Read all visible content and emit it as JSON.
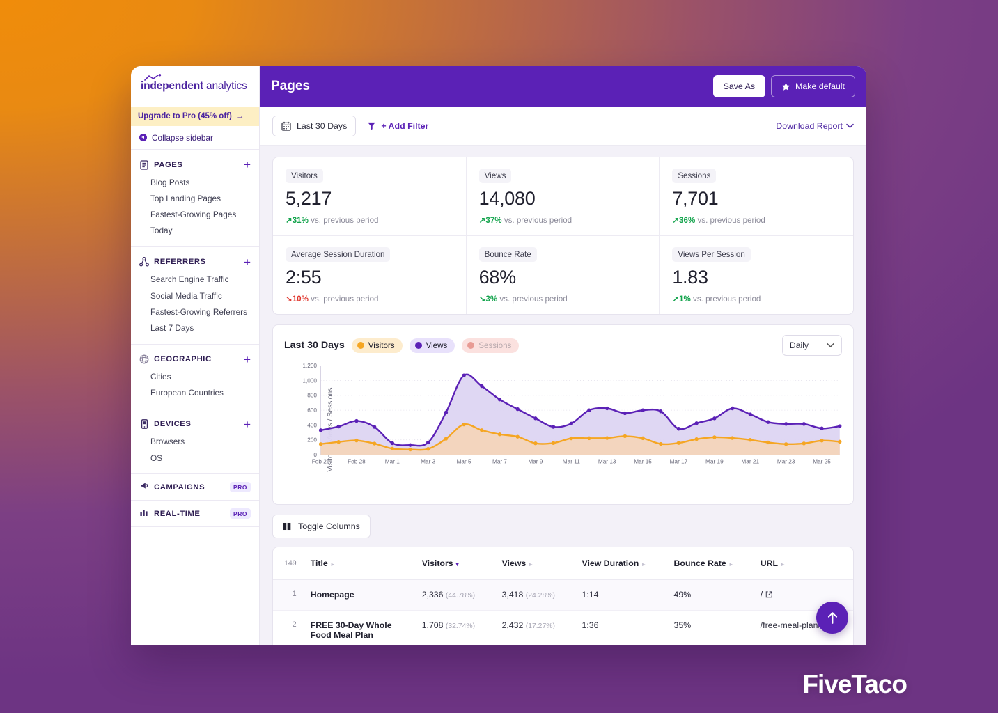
{
  "window": {
    "sidebar": {
      "logo": {
        "bold": "independent",
        "light": " analytics"
      },
      "upgrade": {
        "label": "Upgrade to Pro (45% off)",
        "arrow": "→"
      },
      "collapse": {
        "label": "Collapse sidebar"
      },
      "groups": [
        {
          "title": "PAGES",
          "icon": "document-icon",
          "plus": "+",
          "items": [
            "Blog Posts",
            "Top Landing Pages",
            "Fastest-Growing Pages",
            "Today"
          ]
        },
        {
          "title": "REFERRERS",
          "icon": "share-nodes-icon",
          "plus": "+",
          "items": [
            "Search Engine Traffic",
            "Social Media Traffic",
            "Fastest-Growing Referrers",
            "Last 7 Days"
          ]
        },
        {
          "title": "GEOGRAPHIC",
          "icon": "globe-icon",
          "plus": "+",
          "items": [
            "Cities",
            "European Countries"
          ]
        },
        {
          "title": "DEVICES",
          "icon": "mobile-icon",
          "plus": "+",
          "items": [
            "Browsers",
            "OS"
          ]
        }
      ],
      "pro_rows": [
        {
          "title": "CAMPAIGNS",
          "icon": "megaphone-icon",
          "badge": "PRO"
        },
        {
          "title": "REAL-TIME",
          "icon": "bar-chart-icon",
          "badge": "PRO"
        }
      ]
    },
    "topbar": {
      "title": "Pages",
      "save_as_label": "Save As",
      "make_default_label": "Make default"
    },
    "filterbar": {
      "date_range": "Last 30 Days",
      "add_filter": "+ Add Filter",
      "download_report": "Download Report",
      "chevron": "⌄"
    },
    "stats": [
      {
        "label": "Visitors",
        "value": "5,217",
        "delta": "31%",
        "dir": "up",
        "note": "vs. previous period"
      },
      {
        "label": "Views",
        "value": "14,080",
        "delta": "37%",
        "dir": "up",
        "note": "vs. previous period"
      },
      {
        "label": "Sessions",
        "value": "7,701",
        "delta": "36%",
        "dir": "up",
        "note": "vs. previous period"
      },
      {
        "label": "Average Session Duration",
        "value": "2:55",
        "delta": "10%",
        "dir": "down",
        "note": "vs. previous period"
      },
      {
        "label": "Bounce Rate",
        "value": "68%",
        "delta": "3%",
        "dir": "down",
        "note": "vs. previous period"
      },
      {
        "label": "Views Per Session",
        "value": "1.83",
        "delta": "1%",
        "dir": "up",
        "note": "vs. previous period"
      }
    ],
    "chart_card": {
      "title": "Last 30 Days",
      "legend": [
        {
          "name": "Visitors",
          "color": "#f5a623",
          "active": true
        },
        {
          "name": "Views",
          "color": "#5b21b6",
          "active": true
        },
        {
          "name": "Sessions",
          "color": "#e89b94",
          "active": false
        }
      ],
      "interval_select": {
        "value": "Daily",
        "chevron": "⌄"
      }
    },
    "table": {
      "toggle_columns_label": "Toggle Columns",
      "total_count": "149",
      "columns": [
        "Title",
        "Visitors",
        "Views",
        "View Duration",
        "Bounce Rate",
        "URL"
      ],
      "sorted_column": "Visitors",
      "rows": [
        {
          "index": "1",
          "title": "Homepage",
          "visitors": "2,336",
          "visitors_pct": "(44.78%)",
          "views": "3,418",
          "views_pct": "(24.28%)",
          "view_duration": "1:14",
          "bounce_rate": "49%",
          "url": "/"
        },
        {
          "index": "2",
          "title": "FREE 30-Day Whole Food Meal Plan",
          "visitors": "1,708",
          "visitors_pct": "(32.74%)",
          "views": "2,432",
          "views_pct": "(17.27%)",
          "view_duration": "1:36",
          "bounce_rate": "35%",
          "url": "/free-meal-plan/"
        }
      ]
    },
    "fab": {
      "icon": "arrow-up-icon"
    }
  },
  "watermark": "FiveTaco",
  "colors": {
    "brand_purple": "#5b21b6",
    "visitors_orange": "#f5a623",
    "views_purple": "#5b21b6",
    "sessions_pink": "#e89b94",
    "up_green": "#14a44d",
    "down_red": "#e0342b"
  },
  "chart_data": {
    "type": "area",
    "title": "Last 30 Days",
    "xlabel": "",
    "ylabel": "Visitors / Views / Sessions",
    "ylim": [
      0,
      1200
    ],
    "yticks": [
      0,
      200,
      400,
      600,
      800,
      1000,
      1200
    ],
    "ytick_labels": [
      "0",
      "200",
      "400",
      "600",
      "800",
      "1,000",
      "1,200"
    ],
    "grid": true,
    "legend_position": "top-left",
    "x": [
      "Feb 26",
      "Feb 27",
      "Feb 28",
      "Mar 1",
      "Mar 2",
      "Mar 3",
      "Mar 4",
      "Mar 5",
      "Mar 6",
      "Mar 7",
      "Mar 8",
      "Mar 9",
      "Mar 10",
      "Mar 11",
      "Mar 12",
      "Mar 13",
      "Mar 14",
      "Mar 15",
      "Mar 16",
      "Mar 17",
      "Mar 18",
      "Mar 19",
      "Mar 20",
      "Mar 21",
      "Mar 22",
      "Mar 23",
      "Mar 24",
      "Mar 25",
      "Mar 26",
      "Mar 27"
    ],
    "xtick_labels": [
      "Feb 26",
      "Feb 28",
      "Mar 1",
      "Mar 3",
      "Mar 5",
      "Mar 7",
      "Mar 9",
      "Mar 11",
      "Mar 13",
      "Mar 15",
      "Mar 17",
      "Mar 19",
      "Mar 21",
      "Mar 23",
      "Mar 25"
    ],
    "series": [
      {
        "name": "Views",
        "color": "#5b21b6",
        "fill": "#ddd5f2",
        "values": [
          330,
          380,
          455,
          375,
          155,
          130,
          165,
          570,
          1070,
          925,
          745,
          615,
          490,
          375,
          420,
          600,
          625,
          560,
          600,
          585,
          350,
          425,
          490,
          625,
          545,
          440,
          415,
          415,
          355,
          385
        ]
      },
      {
        "name": "Visitors",
        "color": "#f5a623",
        "fill": "#f3d5bb",
        "values": [
          143,
          172,
          192,
          150,
          82,
          70,
          78,
          215,
          408,
          330,
          275,
          243,
          153,
          157,
          220,
          222,
          225,
          250,
          222,
          145,
          158,
          210,
          235,
          225,
          200,
          165,
          143,
          152,
          190,
          175
        ]
      }
    ]
  }
}
